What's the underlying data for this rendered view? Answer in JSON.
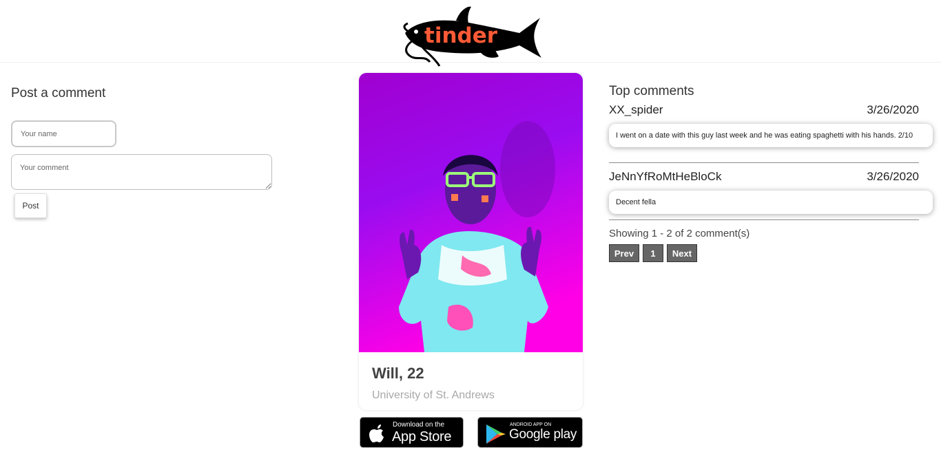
{
  "header": {
    "logo_text": "tinder"
  },
  "post_form": {
    "title": "Post a comment",
    "name_placeholder": "Your name",
    "comment_placeholder": "Your comment",
    "post_label": "Post"
  },
  "profile": {
    "name": "Will, 22",
    "school": "University of St. Andrews"
  },
  "badges": {
    "appstore_small": "Download on the",
    "appstore_big": "App Store",
    "googleplay_small": "ANDROID APP ON",
    "googleplay_big": "Google play"
  },
  "comments": {
    "title": "Top comments",
    "items": [
      {
        "user": "XX_spider",
        "date": "3/26/2020",
        "text": "I went on a date with this guy last week and he was eating spaghetti with his hands. 2/10"
      },
      {
        "user": "JeNnYfRoMtHeBloCk",
        "date": "3/26/2020",
        "text": "Decent fella"
      }
    ],
    "showing": "Showing 1 - 2 of 2 comment(s)",
    "pagination": {
      "prev": "Prev",
      "page": "1",
      "next": "Next"
    }
  },
  "colors": {
    "logo_text": "#ff5a36",
    "photo_top": "#a000d0",
    "photo_bottom": "#ff00e6",
    "pagination_bg": "#666666"
  },
  "icons": [
    "catfish-logo",
    "apple-icon",
    "google-play-icon"
  ]
}
